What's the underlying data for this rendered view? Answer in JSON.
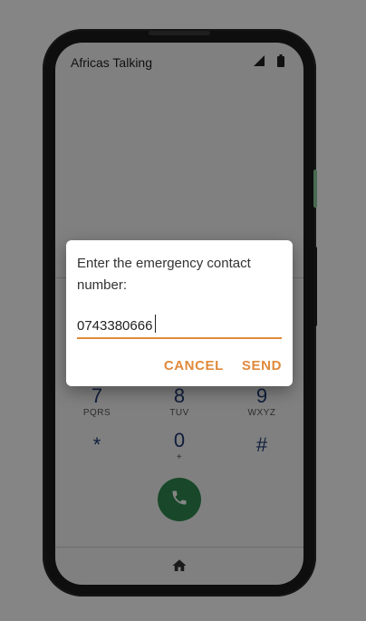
{
  "app": {
    "title": "Africas Talking"
  },
  "status_icons": [
    "signal-icon",
    "battery-icon"
  ],
  "keypad": {
    "keys": [
      {
        "digit": "7",
        "letters": "PQRS"
      },
      {
        "digit": "8",
        "letters": "TUV"
      },
      {
        "digit": "9",
        "letters": "WXYZ"
      },
      {
        "digit": "*",
        "letters": ""
      },
      {
        "digit": "0",
        "letters": "+"
      },
      {
        "digit": "#",
        "letters": ""
      }
    ]
  },
  "call_button": {
    "icon": "phone-icon",
    "color": "#2e8b4f"
  },
  "nav": {
    "icon": "home-icon"
  },
  "dialog": {
    "message": "Enter the emergency contact number:",
    "input_value": "0743380666",
    "cancel_label": "CANCEL",
    "send_label": "SEND",
    "accent_color": "#e08a3c"
  }
}
